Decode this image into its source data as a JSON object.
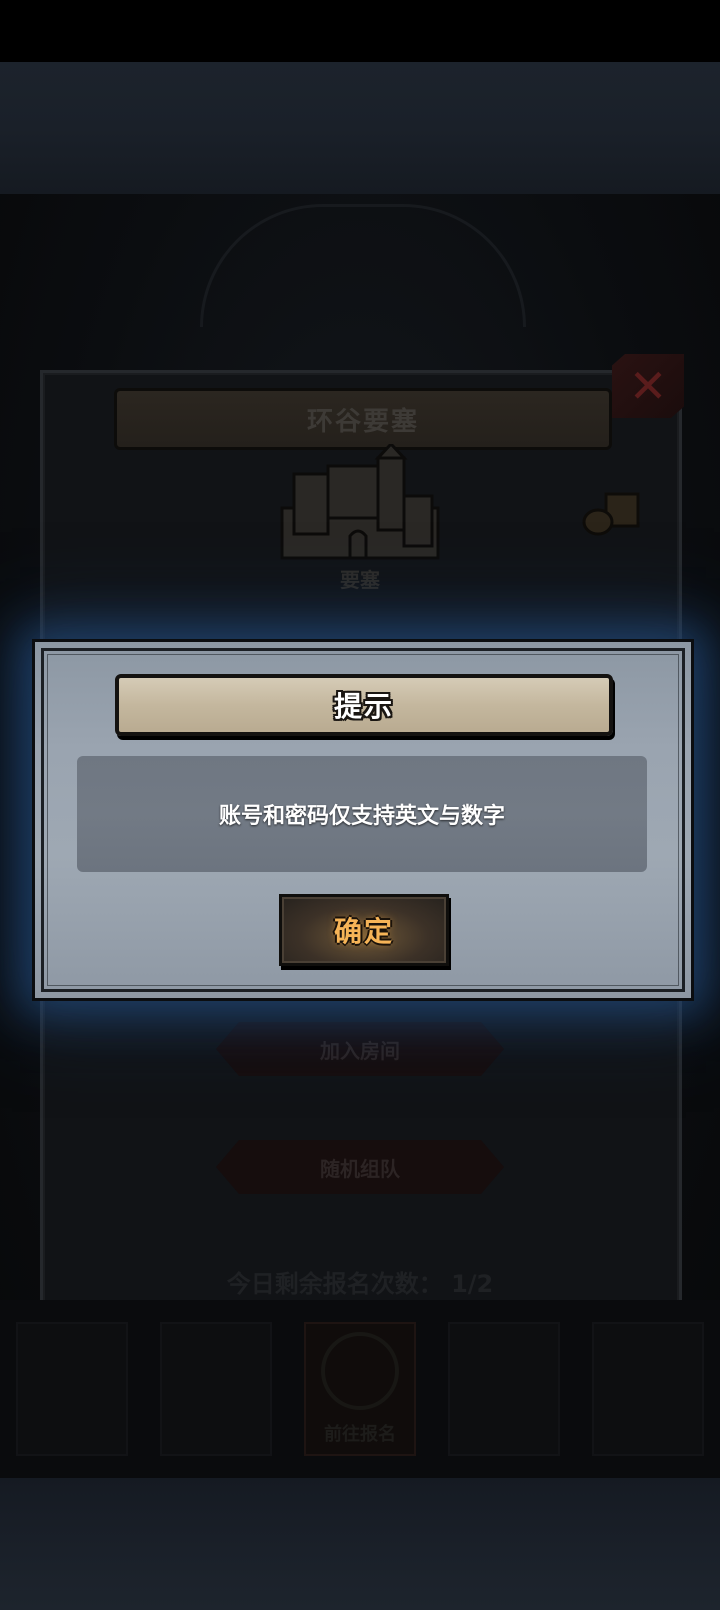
{
  "background_panel": {
    "title": "环谷要塞",
    "building_label": "要塞",
    "close_icon": "close-x-icon",
    "join_room_label": "加入房间",
    "random_team_label": "随机组队",
    "remaining_text": "今日剩余报名次数： 1/2",
    "nav_active_label": "前往报名"
  },
  "modal": {
    "title": "提示",
    "message": "账号和密码仅支持英文与数字",
    "confirm_label": "确定"
  },
  "colors": {
    "modal_glow": "#285a96",
    "confirm_text": "#f6b457",
    "title_plate": "#c4b79e"
  }
}
